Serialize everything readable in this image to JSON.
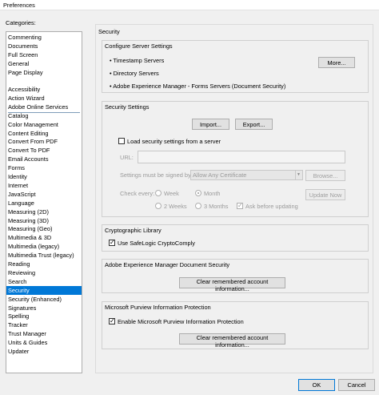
{
  "window": {
    "title": "Preferences"
  },
  "categories_label": "Categories:",
  "categories_top": [
    "Commenting",
    "Documents",
    "Full Screen",
    "General",
    "Page Display"
  ],
  "categories": [
    "Accessibility",
    "Action Wizard",
    "Adobe Online Services",
    "Catalog",
    "Color Management",
    "Content Editing",
    "Convert From PDF",
    "Convert To PDF",
    "Email Accounts",
    "Forms",
    "Identity",
    "Internet",
    "JavaScript",
    "Language",
    "Measuring (2D)",
    "Measuring (3D)",
    "Measuring (Geo)",
    "Multimedia & 3D",
    "Multimedia (legacy)",
    "Multimedia Trust (legacy)",
    "Reading",
    "Reviewing",
    "Search",
    "Security",
    "Security (Enhanced)",
    "Signatures",
    "Spelling",
    "Tracker",
    "Trust Manager",
    "Units & Guides",
    "Updater"
  ],
  "selected_category": "Security",
  "panel": {
    "title": "Security",
    "server": {
      "title": "Configure Server Settings",
      "items": [
        "• Timestamp Servers",
        "• Directory Servers",
        "• Adobe Experience Manager - Forms Servers (Document Security)"
      ],
      "more_button": "More..."
    },
    "security_settings": {
      "title": "Security Settings",
      "import_button": "Import...",
      "export_button": "Export...",
      "load_checkbox": "Load security settings from a server",
      "load_checked": false,
      "url_label": "URL:",
      "url_value": "",
      "signed_label": "Settings must be signed by:",
      "signed_value": "Allow Any Certificate",
      "browse_button": "Browse...",
      "check_every_label": "Check every:",
      "week_label": "Week",
      "month_label": "Month",
      "two_weeks_label": "2 Weeks",
      "three_months_label": "3 Months",
      "ask_label": "Ask before updating",
      "update_button": "Update Now",
      "selected_interval": "Month",
      "ask_checked": true
    },
    "crypto": {
      "title": "Cryptographic Library",
      "checkbox": "Use SafeLogic CryptoComply",
      "checked": true
    },
    "aem": {
      "title": "Adobe Experience Manager Document Security",
      "button": "Clear remembered account information..."
    },
    "purview": {
      "title": "Microsoft Purview Information Protection",
      "checkbox": "Enable Microsoft Purview Information Protection",
      "checked": true,
      "button": "Clear remembered account information..."
    }
  },
  "footer": {
    "ok": "OK",
    "cancel": "Cancel"
  },
  "colors": {
    "selection": "#0078d7",
    "background": "#f0f0f0"
  }
}
